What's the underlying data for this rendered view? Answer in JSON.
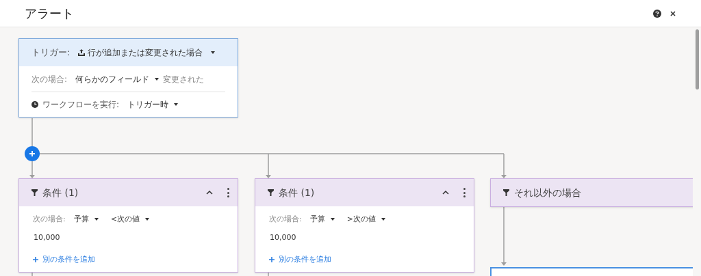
{
  "window": {
    "title": "アラート"
  },
  "trigger": {
    "label": "トリガー:",
    "event": "行が追加または変更された場合",
    "condition_label": "次の場合:",
    "field": "何らかのフィールド",
    "state": "変更された",
    "run_label": "ワークフローを実行:",
    "run_timing": "トリガー時"
  },
  "branches": [
    {
      "kind": "condition",
      "title": "条件 (1)",
      "expanded": true,
      "condition_label": "次の場合:",
      "field": "予算",
      "operator": "<次の値",
      "value": "10,000",
      "add_link": "別の条件を追加"
    },
    {
      "kind": "condition",
      "title": "条件 (1)",
      "expanded": true,
      "condition_label": "次の場合:",
      "field": "予算",
      "operator": ">次の値",
      "value": "10,000",
      "add_link": "別の条件を追加"
    },
    {
      "kind": "else",
      "title": "それ以外の場合"
    }
  ]
}
